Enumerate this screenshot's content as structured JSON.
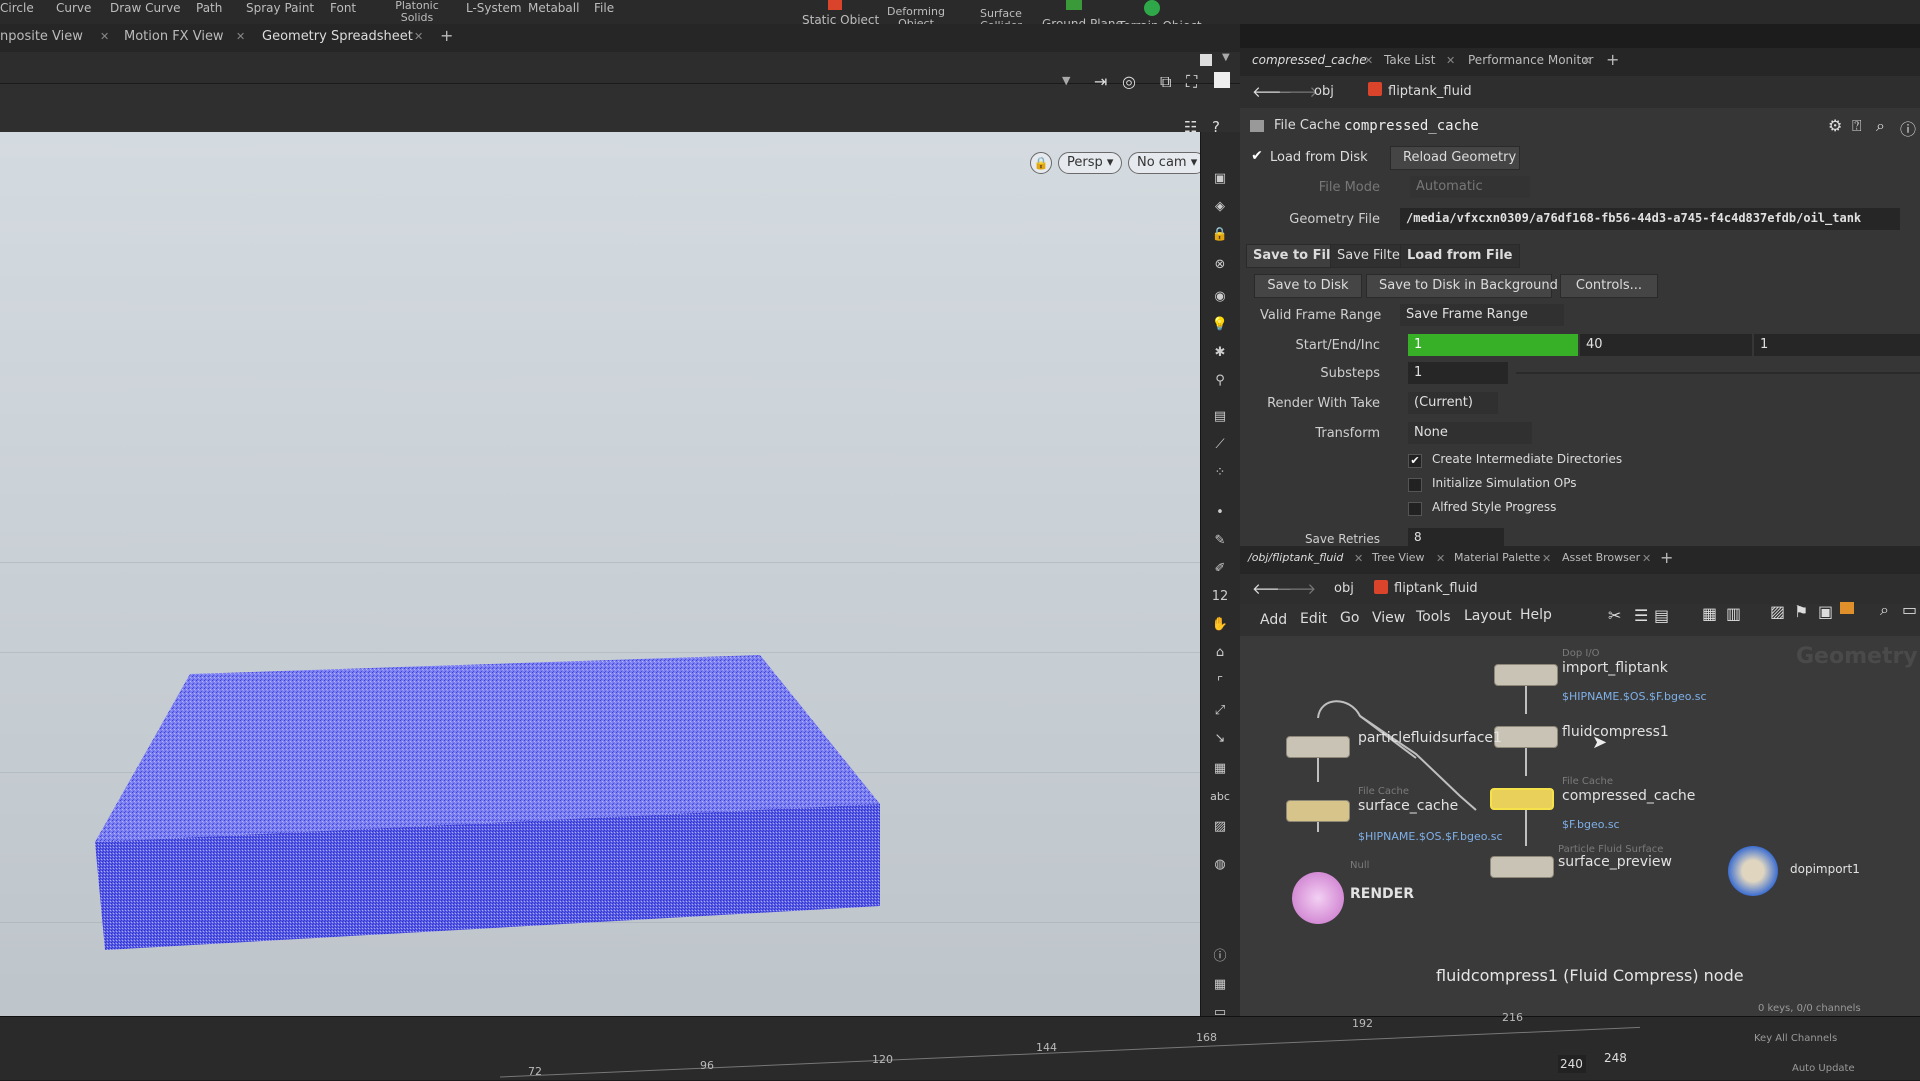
{
  "shelf": {
    "tools": [
      "Circle",
      "Curve",
      "Draw Curve",
      "Path",
      "Spray Paint",
      "Font",
      "Platonic Solids",
      "L-System",
      "Metaball",
      "File",
      "Static Object",
      "Deforming Object",
      "Surface Collider",
      "Ground Plane",
      "Terrain Object"
    ]
  },
  "left_tabs": [
    "nposite View",
    "Motion FX View",
    "Geometry Spreadsheet"
  ],
  "viewport": {
    "camera_mode": "Persp",
    "camera": "No cam"
  },
  "right_tabs": [
    "compressed_cache",
    "Take List",
    "Performance Monitor"
  ],
  "param_nav": {
    "context": "obj",
    "node": "fliptank_fluid"
  },
  "params": {
    "node_type": "File Cache",
    "node_name": "compressed_cache",
    "load_from_disk": "Load from Disk",
    "reload_geometry": "Reload Geometry",
    "file_mode_label": "File Mode",
    "file_mode_value": "Automatic",
    "geometry_file_label": "Geometry File",
    "geometry_file_value": "/media/vfxcxn0309/a76df168-fb56-44d3-a745-f4c4d837efdb/oil_tank",
    "subtabs": [
      "Save to File",
      "Save Filter",
      "Load from File"
    ],
    "save_to_disk": "Save to Disk",
    "save_bg": "Save to Disk in Background",
    "controls": "Controls...",
    "valid_frame_range_label": "Valid Frame Range",
    "valid_frame_range_value": "Save Frame Range",
    "start_end_inc_label": "Start/End/Inc",
    "start": "1",
    "end": "40",
    "inc": "1",
    "substeps_label": "Substeps",
    "substeps_value": "1",
    "render_with_take_label": "Render With Take",
    "render_with_take_value": "(Current)",
    "transform_label": "Transform",
    "transform_value": "None",
    "create_dirs": "Create Intermediate Directories",
    "init_sim": "Initialize Simulation OPs",
    "alfred": "Alfred Style Progress",
    "save_retries_label": "Save Retries",
    "save_retries_value": "8"
  },
  "net_tabs": [
    "/obj/fliptank_fluid",
    "Tree View",
    "Material Palette",
    "Asset Browser"
  ],
  "net_nav": {
    "context": "obj",
    "node": "fliptank_fluid"
  },
  "net_menu": [
    "Add",
    "Edit",
    "Go",
    "View",
    "Tools",
    "Layout",
    "Help"
  ],
  "network": {
    "context_label": "Geometry",
    "nodes": [
      {
        "name": "import_fliptank",
        "type": "Dop I/O",
        "sub": "$HIPNAME.$OS.$F.bgeo.sc"
      },
      {
        "name": "fluidcompress1",
        "type": "",
        "sub": ""
      },
      {
        "name": "particlefluidsurface1",
        "type": "",
        "sub": ""
      },
      {
        "name": "surface_cache",
        "type": "File Cache",
        "sub": "$HIPNAME.$OS.$F.bgeo.sc"
      },
      {
        "name": "compressed_cache",
        "type": "File Cache",
        "sub": "$F.bgeo.sc"
      },
      {
        "name": "surface_preview",
        "type": "Particle Fluid Surface",
        "sub": ""
      },
      {
        "name": "RENDER",
        "type": "Null",
        "sub": ""
      },
      {
        "name": "dopimport1",
        "type": "",
        "sub": ""
      }
    ],
    "status": "fluidcompress1 (Fluid Compress) node"
  },
  "timeline": {
    "ticks": [
      "72",
      "96",
      "120",
      "144",
      "168",
      "192",
      "216"
    ],
    "end_frame": "240",
    "end_frame2": "248",
    "keys_info": "0 keys, 0/0 channels",
    "key_all": "Key All Channels",
    "auto_update": "Auto Update"
  }
}
